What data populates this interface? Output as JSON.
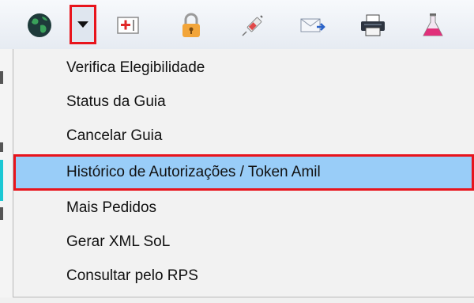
{
  "toolbar": {
    "icons": [
      "globe-icon",
      "dropdown-arrow-icon",
      "medical-form-icon",
      "padlock-icon",
      "syringe-icon",
      "mail-send-icon",
      "printer-icon",
      "lab-flask-icon"
    ]
  },
  "menu": {
    "items": [
      {
        "label": "Verifica Elegibilidade"
      },
      {
        "label": "Status da Guia"
      },
      {
        "label": "Cancelar Guia"
      },
      {
        "label": "Histórico de Autorizações / Token Amil",
        "highlighted": true
      },
      {
        "label": "Mais Pedidos"
      },
      {
        "label": "Gerar XML SoL"
      },
      {
        "label": "Consultar pelo RPS"
      }
    ]
  },
  "colors": {
    "highlight": "#99cdf8",
    "annotation_border": "#e8141c"
  }
}
